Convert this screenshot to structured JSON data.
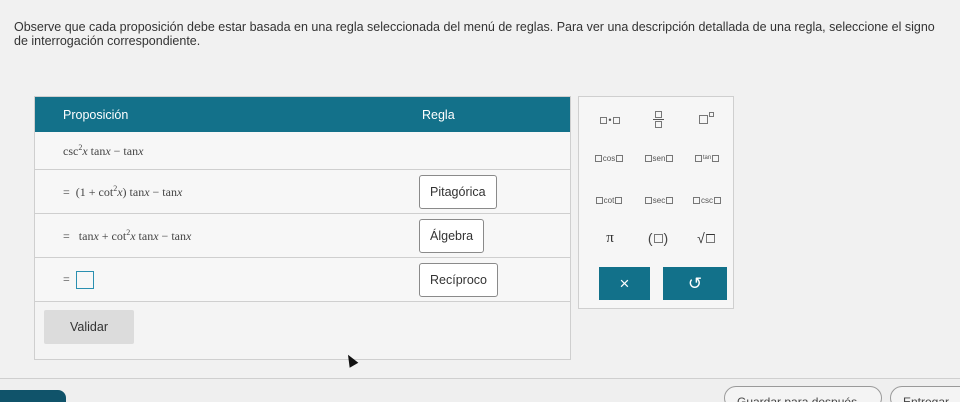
{
  "instructions": "Observe que cada proposición debe estar basada en una regla seleccionada del menú de reglas. Para ver una descripción detallada de una regla, seleccione el signo de interrogación correspondiente.",
  "table": {
    "col_proposition": "Proposición",
    "col_rule": "Regla",
    "rows": [
      {
        "prefix": "",
        "expr_html": "csc<sup>2</sup><i>x</i> tan<i>x</i> − tan<i>x</i>",
        "rule": ""
      },
      {
        "prefix": "=",
        "expr_html": "(1 + cot<sup>2</sup><i>x</i>) tan<i>x</i> − tan<i>x</i>",
        "rule": "Pitagórica"
      },
      {
        "prefix": "=",
        "expr_html": "tan<i>x</i> + cot<sup>2</sup><i>x</i> tan<i>x</i> − tan<i>x</i>",
        "rule": "Álgebra"
      },
      {
        "prefix": "=",
        "expr_html": "",
        "rule": "Recíproco"
      }
    ],
    "validate_label": "Validar"
  },
  "keypad": {
    "trig": [
      "cos",
      "sen",
      "tan",
      "cot",
      "sec",
      "csc"
    ],
    "pi": "π",
    "clear": "×",
    "undo": "↺"
  },
  "footer": {
    "save_later": "Guardar para después",
    "submit": "Entregar"
  },
  "colors": {
    "accent": "#13718a",
    "footer_accent": "#10536a"
  }
}
